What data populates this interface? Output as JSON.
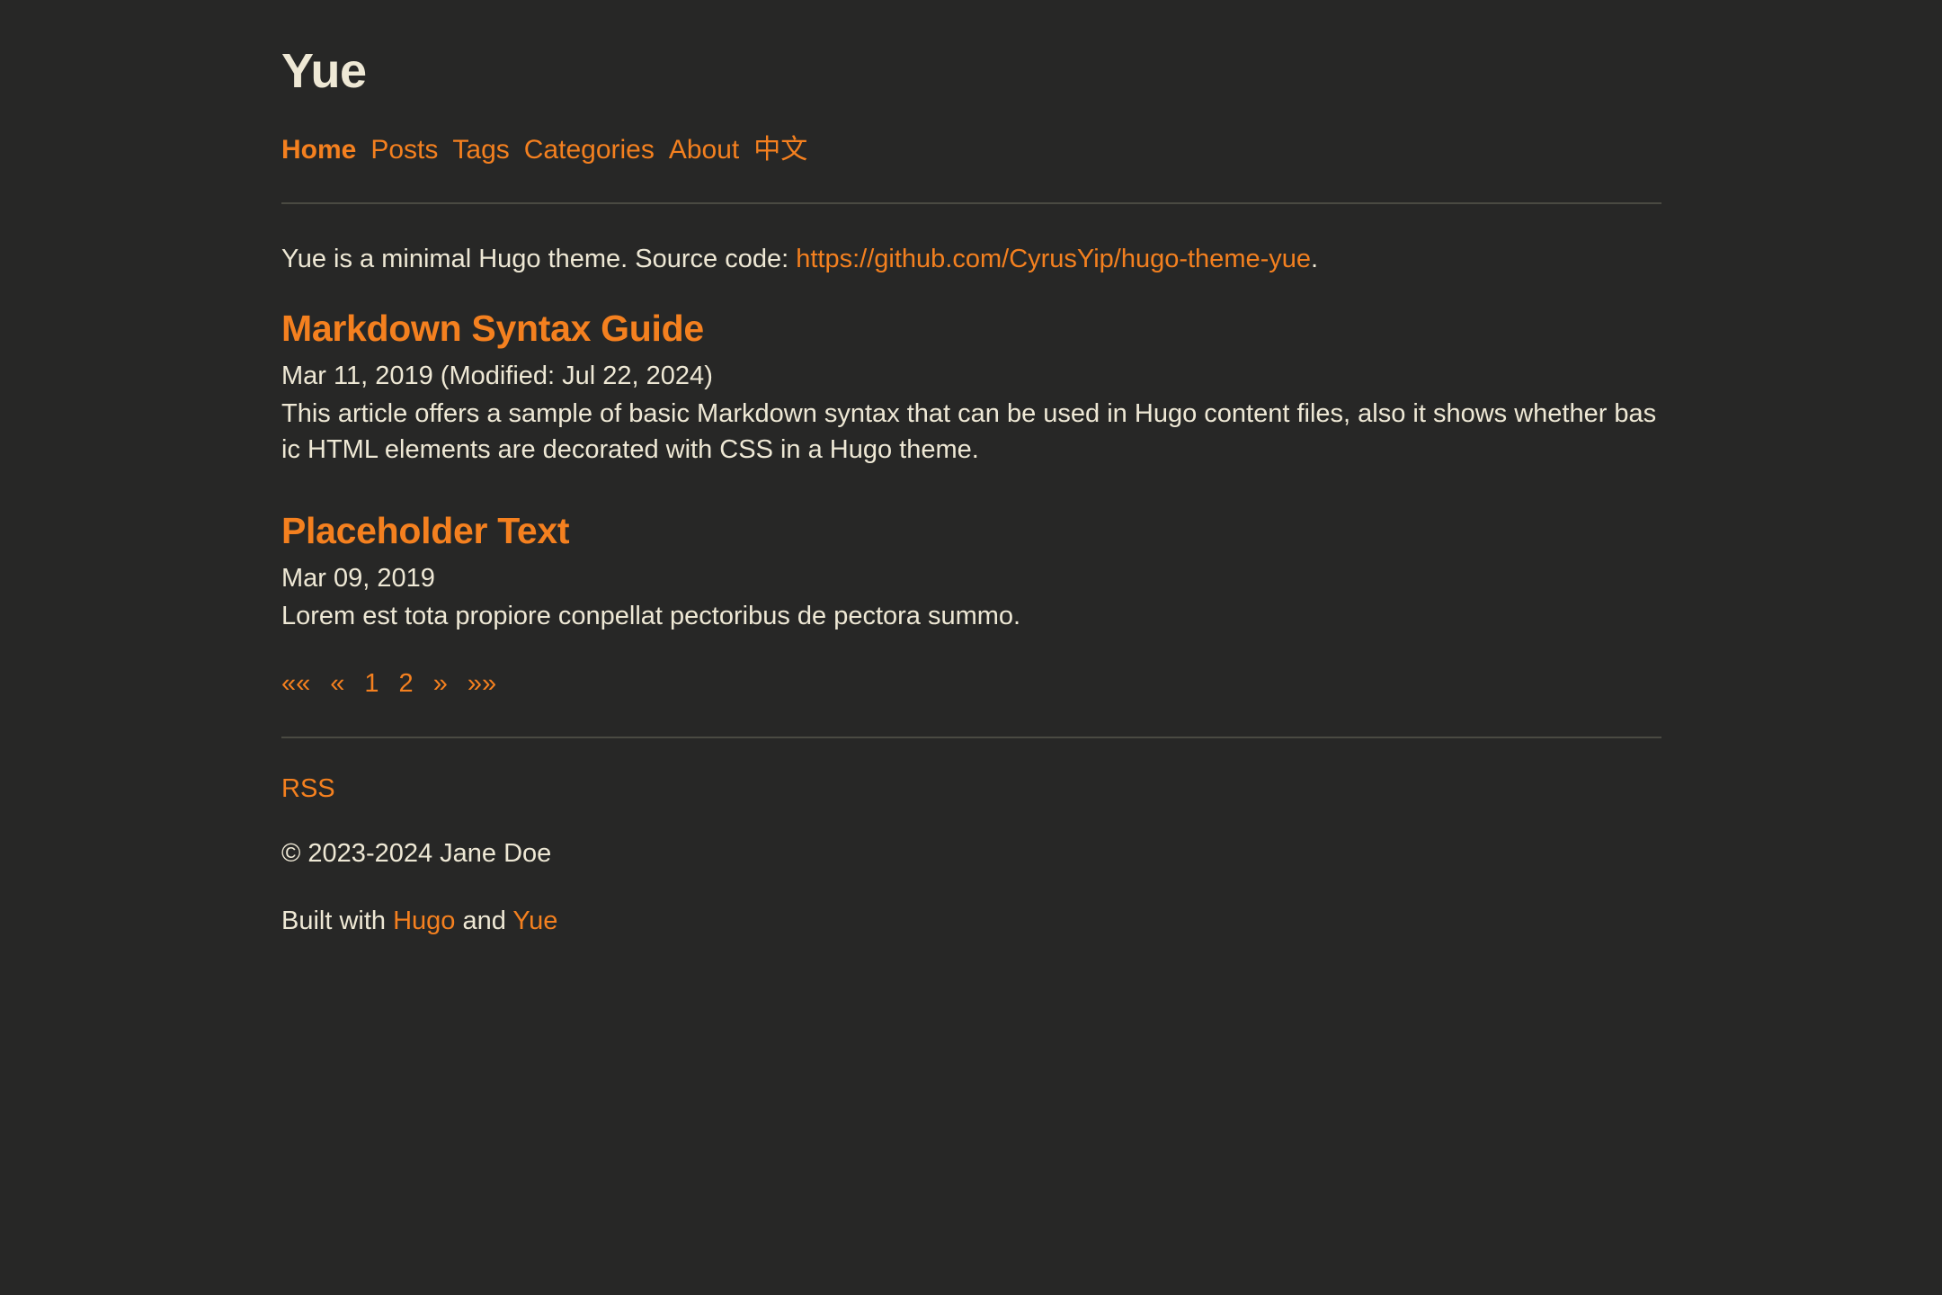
{
  "site": {
    "title": "Yue"
  },
  "nav": {
    "items": [
      {
        "label": "Home",
        "active": true
      },
      {
        "label": "Posts",
        "active": false
      },
      {
        "label": "Tags",
        "active": false
      },
      {
        "label": "Categories",
        "active": false
      },
      {
        "label": "About",
        "active": false
      },
      {
        "label": "中文",
        "active": false
      }
    ]
  },
  "intro": {
    "prefix": "Yue is a minimal Hugo theme. Source code: ",
    "link_text": "https://github.com/CyrusYip/hugo-theme-yue",
    "suffix": "."
  },
  "posts": [
    {
      "title": "Markdown Syntax Guide",
      "date": "Mar 11, 2019 (Modified: Jul 22, 2024)",
      "summary": "This article offers a sample of basic Markdown syntax that can be used in Hugo content files, also it shows whether basic HTML elements are decorated with CSS in a Hugo theme."
    },
    {
      "title": "Placeholder Text",
      "date": "Mar 09, 2019",
      "summary": "Lorem est tota propiore conpellat pectoribus de pectora summo."
    }
  ],
  "pagination": {
    "items": [
      {
        "label": "««",
        "name": "pagination-first"
      },
      {
        "label": "«",
        "name": "pagination-prev"
      },
      {
        "label": "1",
        "name": "pagination-page-1"
      },
      {
        "label": "2",
        "name": "pagination-page-2"
      },
      {
        "label": "»",
        "name": "pagination-next"
      },
      {
        "label": "»»",
        "name": "pagination-last"
      }
    ]
  },
  "footer": {
    "rss_label": "RSS",
    "copyright": "© 2023-2024 Jane Doe",
    "built_prefix": "Built with ",
    "built_engine": "Hugo",
    "built_middle": " and ",
    "built_theme": "Yue"
  },
  "colors": {
    "background": "#272726",
    "text": "#eee8d5",
    "accent": "#f4801f",
    "rule": "#4a4a42"
  }
}
